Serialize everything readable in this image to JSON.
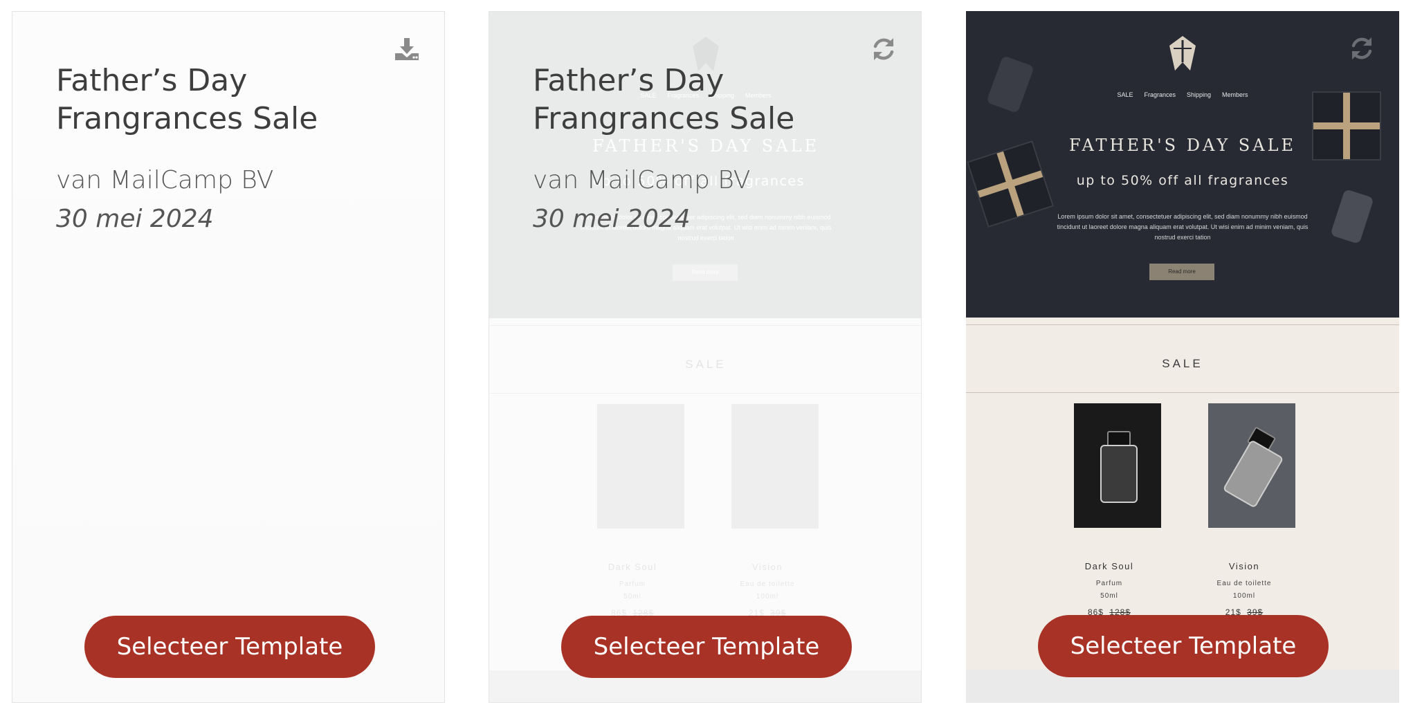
{
  "cards": [
    {
      "title": "Father’s Day Frangrances Sale",
      "author": "van MailCamp BV",
      "date": "30 mei 2024",
      "corner_icon": "download-icon",
      "button_label": "Selecteer Template"
    },
    {
      "title": "Father’s Day Frangrances Sale",
      "author": "van MailCamp BV",
      "date": "30 mei 2024",
      "corner_icon": "refresh-icon",
      "button_label": "Selecteer Template"
    },
    {
      "corner_icon": "refresh-icon",
      "button_label": "Selecteer Template"
    }
  ],
  "preview": {
    "nav": [
      "SALE",
      "Fragrances",
      "Shipping",
      "Members"
    ],
    "headline": "FATHER'S DAY SALE",
    "subheadline": "up to 50% off all fragrances",
    "body": "Lorem ipsum dolor sit amet, consectetuer adipiscing elit, sed diam nonummy nibh euismod tincidunt ut laoreet dolore magna aliquam erat volutpat. Ut wisi enim ad minim veniam, quis nostrud exerci tation",
    "cta": "Read more",
    "section_title": "SALE",
    "products": [
      {
        "name": "Dark Soul",
        "type": "Parfum",
        "size": "50ml",
        "price": "86$",
        "old_price": "128$"
      },
      {
        "name": "Vision",
        "type": "Eau de toilette",
        "size": "100ml",
        "price": "21$",
        "old_price": "39$"
      }
    ]
  },
  "colors": {
    "button": "#a93226",
    "hero_dark": "#272a33",
    "section_bg": "#f1ece6"
  }
}
